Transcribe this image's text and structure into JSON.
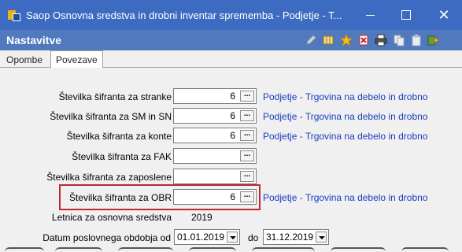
{
  "window": {
    "title": "Saop Osnovna sredstva in drobni inventar sprememba - Podjetje - T...",
    "minimize_icon": "minimize-icon",
    "maximize_icon": "maximize-icon",
    "close_glyph": "✕"
  },
  "header": {
    "title": "Nastavitve",
    "tools": [
      "edit-icon",
      "columns-icon",
      "star-icon",
      "delete-icon",
      "print-icon",
      "copy-icon",
      "paste-icon",
      "exit-icon"
    ]
  },
  "tabs": [
    {
      "label": "Opombe",
      "active": false
    },
    {
      "label": "Povezave",
      "active": true
    }
  ],
  "form": {
    "rows": [
      {
        "label": "Številka šifranta za stranke",
        "value": "6",
        "link": "Podjetje - Trgovina na debelo in drobno"
      },
      {
        "label": "Številka šifranta za SM in SN",
        "value": "6",
        "link": "Podjetje - Trgovina na debelo in drobno"
      },
      {
        "label": "Številka šifranta za konte",
        "value": "6",
        "link": "Podjetje - Trgovina na debelo in drobno"
      },
      {
        "label": "Številka šifranta za FAK",
        "value": "",
        "link": ""
      },
      {
        "label": "Številka šifranta za zaposlene",
        "value": "",
        "link": ""
      },
      {
        "label": "Številka šifranta za OBR",
        "value": "6",
        "link": "Podjetje - Trgovina na debelo in drobno"
      }
    ],
    "dots_label": "...",
    "year": {
      "label": "Letnica za osnovna sredstva",
      "value": "2019"
    },
    "period": {
      "label": "Datum poslovnega obdobja od",
      "from": "01.01.2019",
      "to_label": "do",
      "to": "31.12.2019"
    }
  },
  "colors": {
    "titlebar": "#3c6bc1",
    "header": "#5079be",
    "link": "#1a3dc0",
    "highlight": "#c0282d"
  }
}
